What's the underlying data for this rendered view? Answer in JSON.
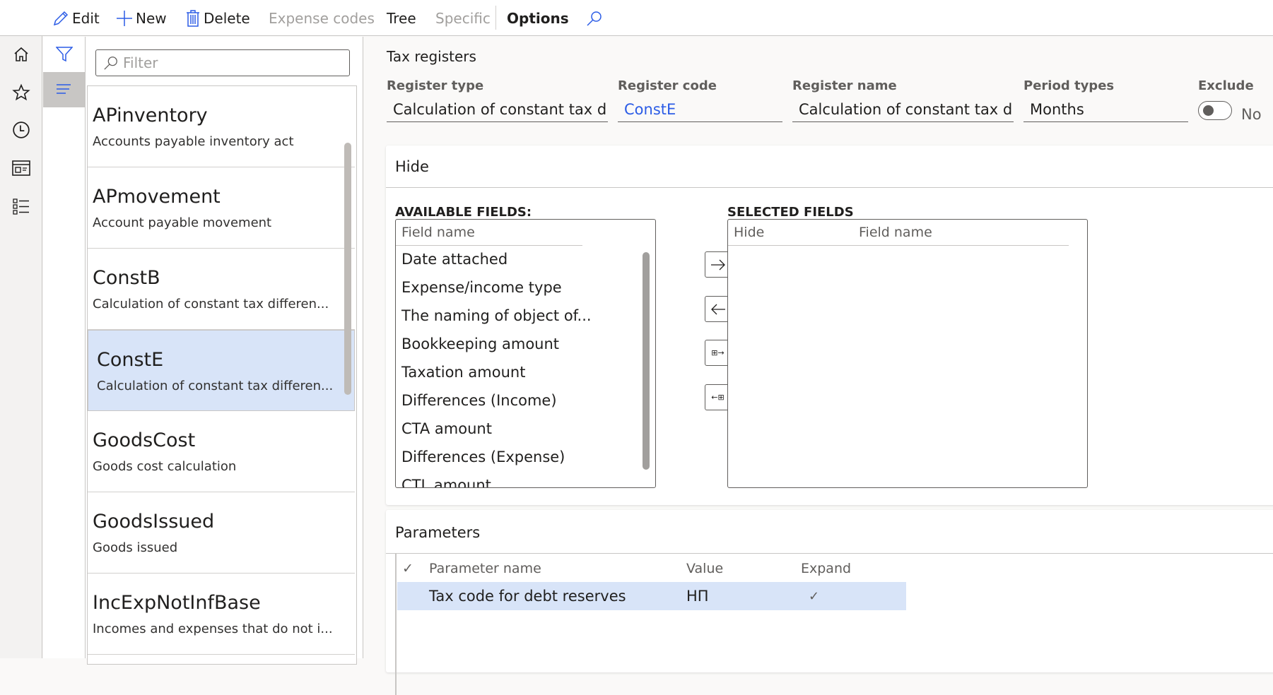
{
  "toolbar": {
    "edit": "Edit",
    "new": "New",
    "delete": "Delete",
    "expense_codes": "Expense codes",
    "tree": "Tree",
    "specific": "Specific",
    "options": "Options"
  },
  "navrail": {
    "items": [
      "hamburger-menu",
      "home",
      "favorites",
      "recent",
      "workspaces",
      "modules"
    ]
  },
  "filter": {
    "placeholder": "Filter"
  },
  "list": {
    "items": [
      {
        "title": "APinventory",
        "subtitle": "Accounts payable inventory act"
      },
      {
        "title": "APmovement",
        "subtitle": "Account payable movement"
      },
      {
        "title": "ConstB",
        "subtitle": "Calculation of constant tax differen..."
      },
      {
        "title": "ConstE",
        "subtitle": "Calculation of constant tax differen...",
        "selected": true
      },
      {
        "title": "GoodsCost",
        "subtitle": "Goods cost calculation"
      },
      {
        "title": "GoodsIssued",
        "subtitle": "Goods issued"
      },
      {
        "title": "IncExpNotInfBase",
        "subtitle": "Incomes and expenses that do not i..."
      }
    ]
  },
  "form": {
    "title": "Tax registers",
    "fields": {
      "register_type": {
        "label": "Register type",
        "value": "Calculation of constant tax di..."
      },
      "register_code": {
        "label": "Register code",
        "value": "ConstE"
      },
      "register_name": {
        "label": "Register name",
        "value": "Calculation of constant tax di..."
      },
      "period_types": {
        "label": "Period types",
        "value": "Months"
      },
      "exclude": {
        "label": "Exclude",
        "value": "No",
        "on": false
      }
    }
  },
  "hide_section": {
    "title": "Hide",
    "available_label": "AVAILABLE FIELDS:",
    "available_header": "Field name",
    "available_fields": [
      "Date attached",
      "Expense/income type",
      "The naming of object of...",
      "Bookkeeping amount",
      "Taxation amount",
      "Differences (Income)",
      "CTA amount",
      "Differences (Expense)",
      "CTL amount"
    ],
    "selected_label": "SELECTED FIELDS",
    "selected_headers": [
      "Hide",
      "Field name"
    ],
    "selected_fields": [],
    "buttons": {
      "add": "→",
      "remove": "←",
      "add_all": "⊞→",
      "remove_all": "←⊞"
    }
  },
  "parameters_section": {
    "title": "Parameters",
    "headers": {
      "check": "✓",
      "name": "Parameter name",
      "value": "Value",
      "expand": "Expand"
    },
    "rows": [
      {
        "name": "Tax code for debt reserves",
        "value": "НП",
        "expand": "✓"
      }
    ]
  },
  "colors": {
    "accent": "#2b5ce6",
    "selection": "#d8e4f8",
    "background": "#faf9f8"
  }
}
